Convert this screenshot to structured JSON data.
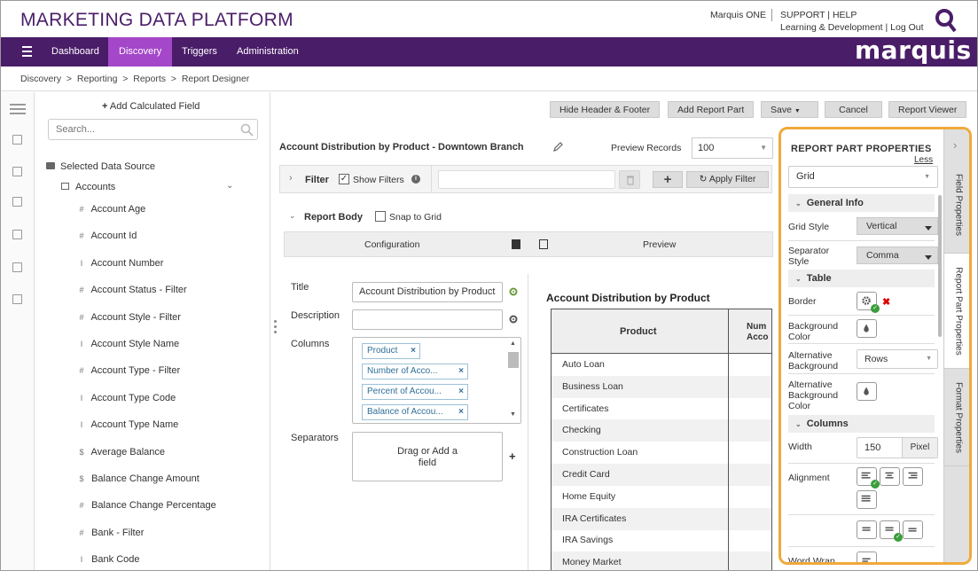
{
  "app": {
    "brand_title": "MARKETING DATA PLATFORM",
    "user": "Marquis ONE",
    "links_top": [
      "SUPPORT",
      "HELP"
    ],
    "links_bottom": [
      "Learning & Development",
      "Log Out"
    ],
    "logo_text": "marquis"
  },
  "nav": {
    "items": [
      "Dashboard",
      "Discovery",
      "Triggers",
      "Administration"
    ],
    "active": "Discovery"
  },
  "breadcrumb": [
    "Discovery",
    "Reporting",
    "Reports",
    "Report Designer"
  ],
  "fields_panel": {
    "add_calculated_field": "Add Calculated Field",
    "search_placeholder": "Search...",
    "source_label": "Selected Data Source",
    "table_label": "Accounts",
    "fields": [
      {
        "type": "#",
        "name": "Account Age"
      },
      {
        "type": "#",
        "name": "Account Id"
      },
      {
        "type": "I",
        "name": "Account Number"
      },
      {
        "type": "#",
        "name": "Account Status - Filter"
      },
      {
        "type": "#",
        "name": "Account Style - Filter"
      },
      {
        "type": "I",
        "name": "Account Style Name"
      },
      {
        "type": "#",
        "name": "Account Type - Filter"
      },
      {
        "type": "I",
        "name": "Account Type Code"
      },
      {
        "type": "I",
        "name": "Account Type Name"
      },
      {
        "type": "$",
        "name": "Average Balance"
      },
      {
        "type": "$",
        "name": "Balance Change Amount"
      },
      {
        "type": "#",
        "name": "Balance Change Percentage"
      },
      {
        "type": "#",
        "name": "Bank - Filter"
      },
      {
        "type": "I",
        "name": "Bank Code"
      }
    ]
  },
  "toolbar": {
    "hide_header_footer": "Hide Header & Footer",
    "add_report_part": "Add Report Part",
    "save": "Save",
    "cancel": "Cancel",
    "report_viewer": "Report Viewer"
  },
  "report": {
    "title": "Account Distribution by Product - Downtown Branch",
    "preview_records_label": "Preview Records",
    "preview_records_value": "100",
    "filter_label": "Filter",
    "show_filters_label": "Show Filters",
    "apply_filter": "Apply Filter",
    "report_body_label": "Report Body",
    "snap_to_grid": "Snap to Grid"
  },
  "config": {
    "configuration_header": "Configuration",
    "preview_header": "Preview",
    "title_label": "Title",
    "title_value": "Account Distribution by Product",
    "description_label": "Description",
    "description_value": "",
    "columns_label": "Columns",
    "columns": [
      "Product",
      "Number of Acco...",
      "Percent of Accou...",
      "Balance of Accou..."
    ],
    "separators_label": "Separators",
    "drag_add_line1": "Drag or Add a",
    "drag_add_line2": "field"
  },
  "preview": {
    "title": "Account Distribution by Product",
    "col1_header": "Product",
    "col2_header_line1": "Num",
    "col2_header_line2": "Acco",
    "rows": [
      "Auto Loan",
      "Business Loan",
      "Certificates",
      "Checking",
      "Construction Loan",
      "Credit Card",
      "Home Equity",
      "IRA Certificates",
      "IRA Savings",
      "Money Market"
    ]
  },
  "properties": {
    "title": "REPORT PART PROPERTIES",
    "less_link": "Less",
    "type_value": "Grid",
    "general_info": "General Info",
    "grid_style_label": "Grid Style",
    "grid_style_value": "Vertical",
    "separator_style_label": "Separator Style",
    "separator_style_value": "Comma",
    "table_section": "Table",
    "border_label": "Border",
    "background_color_label": "Background Color",
    "alternative_background_label": "Alternative Background",
    "alternative_background_value": "Rows",
    "alternative_background_color_label": "Alternative Background Color",
    "columns_section": "Columns",
    "width_label": "Width",
    "width_value": "150",
    "width_unit": "Pixel",
    "alignment_label": "Alignment",
    "word_wrap_label": "Word Wrap",
    "side_tabs": [
      "Field Properties",
      "Report Part Properties",
      "Format Properties"
    ],
    "highlight_color": "#f0a93a"
  },
  "colors": {
    "nav_bg": "#4a1d68",
    "nav_active": "#a447c9",
    "brand": "#4a1d68"
  }
}
